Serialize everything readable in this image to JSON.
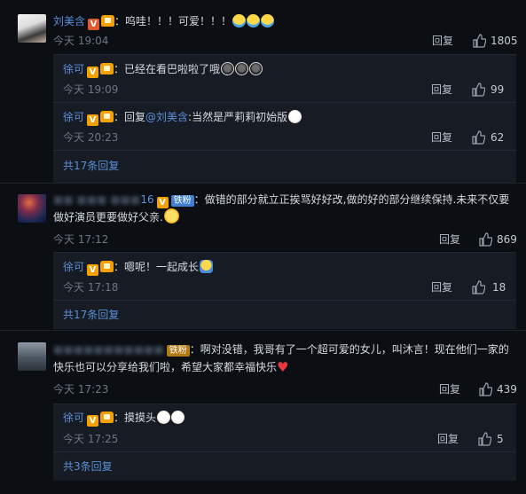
{
  "comments": [
    {
      "user": "刘美含",
      "text": "：呜哇！！！可爱！！！",
      "time": "今天 19:04",
      "reply": "回复",
      "likes": "1805",
      "replies": [
        {
          "user": "徐可",
          "text": "：已经在看巴啦啦了哦",
          "time": "今天 19:09",
          "reply": "回复",
          "likes": "99"
        },
        {
          "user": "徐可",
          "text_prefix": "：回复",
          "mention": "@刘美含",
          "text": ":当然是严莉莉初始版",
          "time": "今天 20:23",
          "reply": "回复",
          "likes": "62"
        }
      ],
      "more": "共17条回复"
    },
    {
      "user_visible_suffix": "16",
      "badge": "铁粉",
      "text": "：做错的部分就立正挨骂好好改,做的好的部分继续保持.未来不仅要做好演员更要做好父亲.",
      "time": "今天 17:12",
      "reply": "回复",
      "likes": "869",
      "replies": [
        {
          "user": "徐可",
          "text": "：嗯呢！一起成长",
          "time": "今天 17:18",
          "reply": "回复",
          "likes": "18"
        }
      ],
      "more": "共17条回复"
    },
    {
      "badge": "铁粉",
      "text": "：啊对没错，我哥有了一个超可爱的女儿，叫沐言！现在他们一家的快乐也可以分享给我们啦，希望大家都幸福快乐",
      "time": "今天 17:23",
      "reply": "回复",
      "likes": "439",
      "replies": [
        {
          "user": "徐可",
          "text": "：摸摸头",
          "time": "今天 17:25",
          "reply": "回复",
          "likes": "5"
        }
      ],
      "more": "共3条回复"
    }
  ],
  "icons": {
    "verified": "V",
    "like": "thumbs-up-icon"
  },
  "colors": {
    "background": "#0b0e13",
    "panel": "#161b24",
    "link": "#5b8fd6",
    "verified_badge": "#f2a100",
    "iron_badge": "#3e7fd0"
  }
}
